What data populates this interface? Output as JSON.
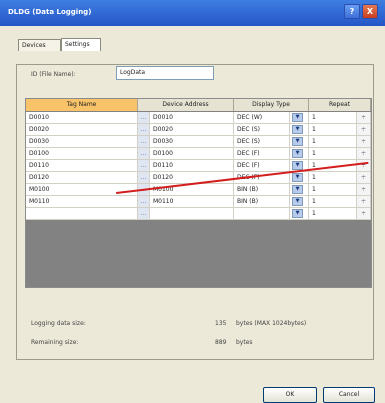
{
  "window": {
    "title": "DLDG (Data Logging)",
    "help_glyph": "?",
    "close_glyph": "X"
  },
  "tabs": [
    {
      "label": "Devices"
    },
    {
      "label": "Settings"
    }
  ],
  "file": {
    "label": "ID (File Name):",
    "value": "LogData"
  },
  "table": {
    "headers": [
      "Tag Name",
      "Device Address",
      "Display Type",
      "Repeat"
    ],
    "dots": "...",
    "rows": [
      {
        "tag": "D0010",
        "address": "D0010",
        "display": "DEC (W)",
        "repeat": "1",
        "spin": "÷"
      },
      {
        "tag": "D0020",
        "address": "D0020",
        "display": "DEC (S)",
        "repeat": "1",
        "spin": "÷"
      },
      {
        "tag": "D0030",
        "address": "D0030",
        "display": "DEC (S)",
        "repeat": "1",
        "spin": "÷"
      },
      {
        "tag": "D0100",
        "address": "D0100",
        "display": "DEC (F)",
        "repeat": "1",
        "spin": "÷"
      },
      {
        "tag": "D0110",
        "address": "D0110",
        "display": "DEC (F)",
        "repeat": "1",
        "spin": "÷"
      },
      {
        "tag": "D0120",
        "address": "D0120",
        "display": "DEC (F)",
        "repeat": "1",
        "spin": "÷"
      },
      {
        "tag": "M0100",
        "address": "M0100",
        "display": "BIN (B)",
        "repeat": "1",
        "spin": "÷"
      },
      {
        "tag": "M0110",
        "address": "M0110",
        "display": "BIN (B)",
        "repeat": "1",
        "spin": "÷"
      },
      {
        "tag": "",
        "address": "",
        "display": "",
        "repeat": "1",
        "spin": "÷"
      }
    ]
  },
  "summary": {
    "logging_label": "Logging data size:",
    "logging_value": "135",
    "logging_unit": "bytes (MAX 1024bytes)",
    "remaining_label": "Remaining size:",
    "remaining_value": "889",
    "remaining_unit": "bytes"
  },
  "buttons": {
    "ok": "OK",
    "cancel": "Cancel"
  },
  "colors": {
    "titlebar": "#2456c8",
    "header_highlight": "#f9c36a",
    "annotation_arrow": "#d31e1e"
  }
}
